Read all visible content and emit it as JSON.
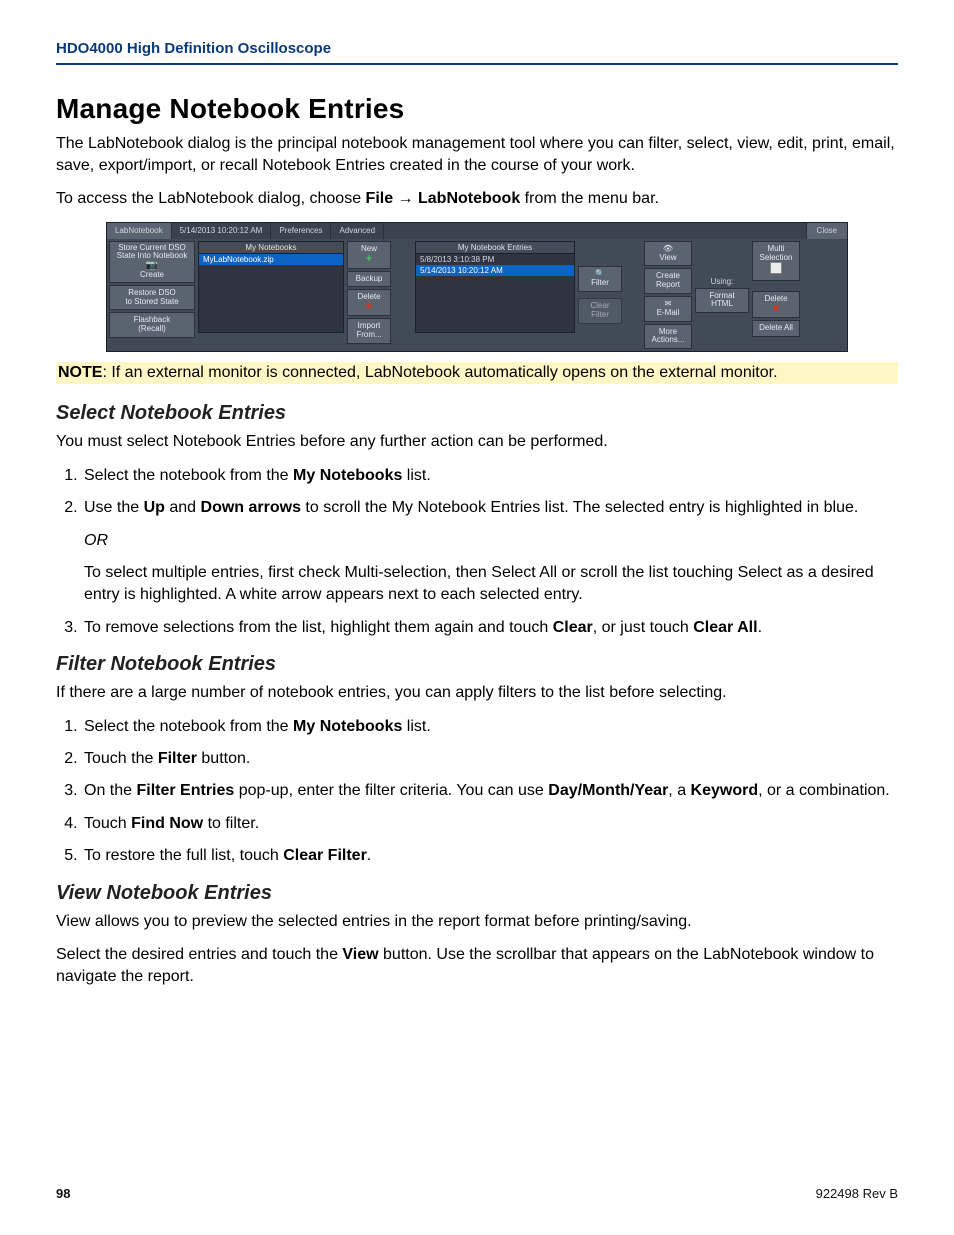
{
  "header": {
    "running": "HDO4000 High Definition Oscilloscope"
  },
  "title": "Manage Notebook Entries",
  "intro1": "The LabNotebook dialog is the principal notebook management tool where you can filter, select, view, edit, print, email, save, export/import, or recall Notebook Entries created in the course of your work.",
  "intro2_pre": "To access the LabNotebook dialog, choose ",
  "intro2_file": "File",
  "intro2_arrow": " → ",
  "intro2_ln": "LabNotebook",
  "intro2_post": " from the menu bar.",
  "note": {
    "label": "NOTE",
    "text": ": If an external monitor is connected, LabNotebook automatically opens on the external monitor."
  },
  "select": {
    "heading": "Select Notebook Entries",
    "lead": "You must select Notebook Entries before any further action can be performed.",
    "step1_pre": "Select the notebook from the ",
    "step1_b": "My Notebooks",
    "step1_post": " list.",
    "step2_a": "Use the ",
    "step2_up": "Up",
    "step2_b": " and ",
    "step2_down": "Down arrows",
    "step2_c": " to scroll the My Notebook Entries list. The selected entry is highlighted in blue.",
    "or": "OR",
    "step2_alt": "To select multiple entries, first check Multi-selection, then Select All or scroll the list touching Select as a desired entry is highlighted. A white arrow appears next to each selected entry.",
    "step3_a": "To remove selections from the list, highlight them again and touch ",
    "step3_clear": "Clear",
    "step3_b": ", or just touch ",
    "step3_clearall": "Clear All",
    "step3_c": "."
  },
  "filter": {
    "heading": "Filter Notebook Entries",
    "lead": "If there are a large number of notebook entries, you can apply filters to the list before selecting.",
    "s1_pre": "Select the notebook from the ",
    "s1_b": "My Notebooks",
    "s1_post": " list.",
    "s2_pre": "Touch the ",
    "s2_b": "Filter",
    "s2_post": " button.",
    "s3_a": "On the ",
    "s3_b1": "Filter Entries",
    "s3_b": " pop-up, enter the filter criteria. You can use ",
    "s3_b2": "Day/Month/Year",
    "s3_c": ", a ",
    "s3_b3": "Keyword",
    "s3_d": ", or a combination.",
    "s4_pre": "Touch ",
    "s4_b": "Find Now",
    "s4_post": " to filter.",
    "s5_pre": "To restore the full list, touch ",
    "s5_b": "Clear Filter",
    "s5_post": "."
  },
  "view": {
    "heading": "View Notebook Entries",
    "lead": "View allows you to preview the selected entries in the report format before printing/saving.",
    "p_a": "Select the desired entries and touch the ",
    "p_b": "View",
    "p_c": " button. Use the scrollbar that appears on the LabNotebook window to navigate the report."
  },
  "footer": {
    "page": "98",
    "doc": "922498 Rev B"
  },
  "dialog": {
    "tabs": {
      "main": "LabNotebook",
      "ts": "5/14/2013 10:20:12 AM",
      "prefs": "Preferences",
      "adv": "Advanced"
    },
    "close": "Close",
    "left": {
      "store1": "Store Current DSO",
      "store2": "State Into Notebook",
      "create": "Create",
      "restore1": "Restore DSO",
      "restore2": "to Stored State",
      "flash1": "Flashback",
      "flash2": "(Recall)"
    },
    "mynb": {
      "header": "My Notebooks",
      "row1": "MyLabNotebook.zip"
    },
    "nbact": {
      "new": "New",
      "backup": "Backup",
      "delete": "Delete",
      "import": "Import From..."
    },
    "entries": {
      "header": "My Notebook Entries",
      "row1": "5/8/2013 3:10:38 PM",
      "row2": "5/14/2013 10:20:12 AM"
    },
    "entact": {
      "filter": "Filter",
      "clear": "Clear Filter"
    },
    "right": {
      "view": "View",
      "createrep": "Create Report",
      "email": "E-Mail",
      "more": "More Actions...",
      "using": "Using:",
      "format": "Format",
      "html": "HTML",
      "multi": "Multi Selection",
      "delete": "Delete",
      "deleteall": "Delete All"
    }
  }
}
